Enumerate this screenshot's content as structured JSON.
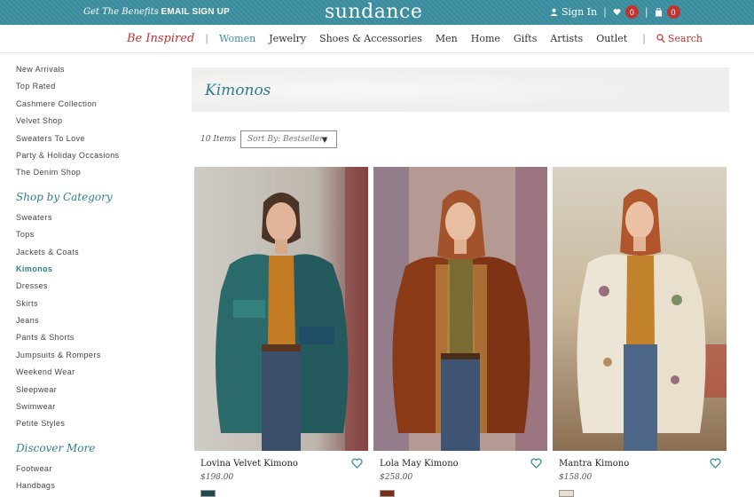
{
  "topbar": {
    "promo_italic": "Get The Benefits",
    "promo_bold": "EMAIL SIGN UP",
    "logo": "sundance",
    "sign_in": "Sign In",
    "wishlist_count": "0",
    "cart_count": "0"
  },
  "nav": {
    "brand": "Be Inspired",
    "items": [
      "Women",
      "Jewelry",
      "Shoes & Accessories",
      "Men",
      "Home",
      "Gifts",
      "Artists",
      "Outlet"
    ],
    "search": "Search"
  },
  "sidebar": {
    "featured": [
      "New Arrivals",
      "Top Rated",
      "Cashmere Collection",
      "Velvet Shop",
      "Sweaters To Love",
      "Party & Holiday Occasions",
      "The Denim Shop"
    ],
    "category_heading": "Shop by Category",
    "categories": [
      "Sweaters",
      "Tops",
      "Jackets & Coats",
      "Kimonos",
      "Dresses",
      "Skirts",
      "Jeans",
      "Pants & Shorts",
      "Jumpsuits & Rompers",
      "Weekend Wear",
      "Sleepwear",
      "Swimwear",
      "Petite Styles"
    ],
    "discover_heading": "Discover More",
    "discover": [
      "Footwear",
      "Handbags"
    ]
  },
  "main": {
    "title": "Kimonos",
    "item_count": "10 Items",
    "sort_label": "Sort By: Bestsellers"
  },
  "products": [
    {
      "name": "Lovina Velvet Kimono",
      "price": "$198.00",
      "swatch_color": "#1f4a4c"
    },
    {
      "name": "Lola May Kimono",
      "price": "$258.00",
      "swatch_color": "#7a2e14"
    },
    {
      "name": "Mantra Kimono",
      "price": "$158.00",
      "swatch_color": "#e8e0cf"
    }
  ],
  "colors": {
    "teal": "#3b8fa0",
    "accent_red": "#c0332f",
    "link_teal": "#2f7f91"
  }
}
